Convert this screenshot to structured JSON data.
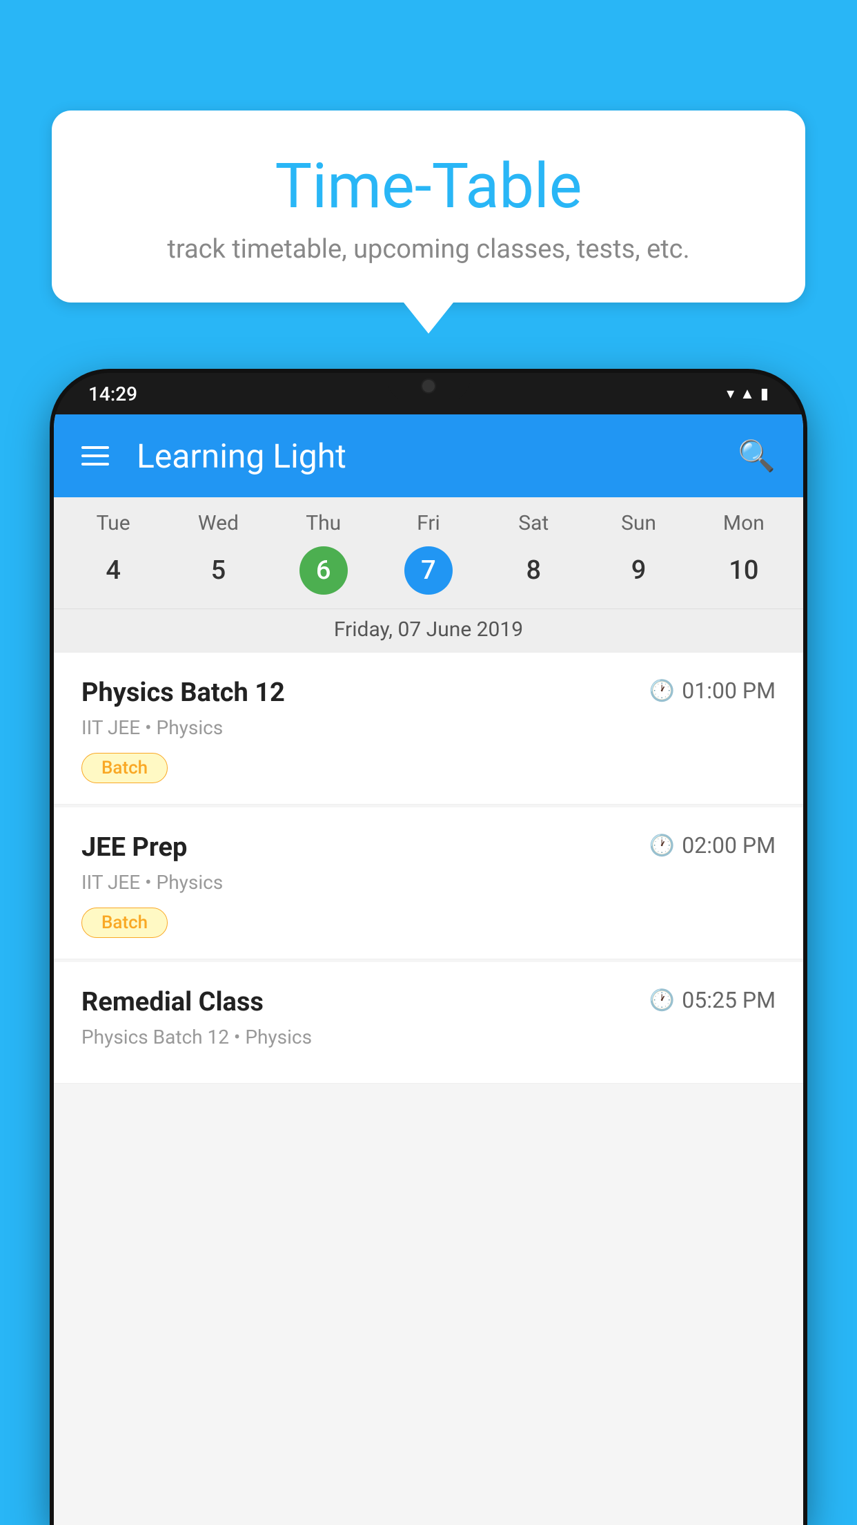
{
  "background": {
    "color": "#29B6F6"
  },
  "bubble": {
    "title": "Time-Table",
    "subtitle": "track timetable, upcoming classes, tests, etc."
  },
  "phone": {
    "status_bar": {
      "time": "14:29"
    },
    "app_bar": {
      "title": "Learning Light"
    },
    "calendar": {
      "days": [
        {
          "name": "Tue",
          "num": "4",
          "state": "normal"
        },
        {
          "name": "Wed",
          "num": "5",
          "state": "normal"
        },
        {
          "name": "Thu",
          "num": "6",
          "state": "today"
        },
        {
          "name": "Fri",
          "num": "7",
          "state": "selected"
        },
        {
          "name": "Sat",
          "num": "8",
          "state": "normal"
        },
        {
          "name": "Sun",
          "num": "9",
          "state": "normal"
        },
        {
          "name": "Mon",
          "num": "10",
          "state": "normal"
        }
      ],
      "selected_date_label": "Friday, 07 June 2019"
    },
    "schedule": [
      {
        "title": "Physics Batch 12",
        "time": "01:00 PM",
        "meta": "IIT JEE • Physics",
        "tag": "Batch"
      },
      {
        "title": "JEE Prep",
        "time": "02:00 PM",
        "meta": "IIT JEE • Physics",
        "tag": "Batch"
      },
      {
        "title": "Remedial Class",
        "time": "05:25 PM",
        "meta": "Physics Batch 12 • Physics",
        "tag": ""
      }
    ]
  }
}
